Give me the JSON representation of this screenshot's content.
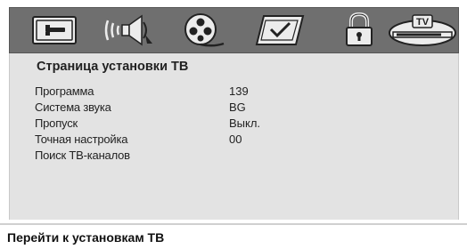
{
  "page": {
    "title": "Страница установки ТВ"
  },
  "icons": [
    "settings-tab-icon",
    "audio-tab-icon",
    "disc-video-tab-icon",
    "preferences-tab-icon",
    "lock-tab-icon",
    "tv-tab-icon"
  ],
  "tv_tab": {
    "label": "TV"
  },
  "menu": {
    "items": [
      {
        "label": "Программа",
        "value": "139"
      },
      {
        "label": "Система звука",
        "value": "BG"
      },
      {
        "label": "Пропуск",
        "value": "Выкл."
      },
      {
        "label": "Точная настройка",
        "value": "00"
      },
      {
        "label": "Поиск ТВ-каналов",
        "value": ""
      }
    ]
  },
  "footer": {
    "hint": "Перейти к установкам ТВ"
  },
  "colors": {
    "icon_bar": "#6f6f6f",
    "panel": "#e3e3e3",
    "icon_face": "#ececec"
  }
}
